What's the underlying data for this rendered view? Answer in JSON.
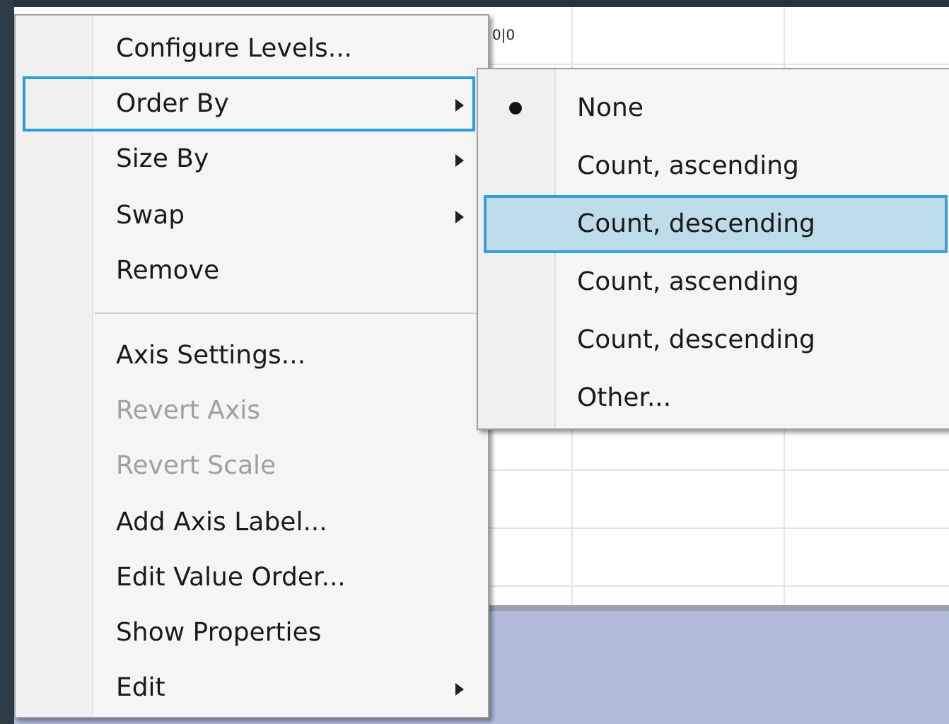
{
  "background": {
    "cell_text": "0|0"
  },
  "context_menu": {
    "items": [
      {
        "kind": "item",
        "label": "Configure Levels...",
        "disabled": false,
        "selected": false,
        "submenu": false
      },
      {
        "kind": "item",
        "label": "Order By",
        "disabled": false,
        "selected": true,
        "submenu": true
      },
      {
        "kind": "item",
        "label": "Size By",
        "disabled": false,
        "selected": false,
        "submenu": true
      },
      {
        "kind": "item",
        "label": "Swap",
        "disabled": false,
        "selected": false,
        "submenu": true
      },
      {
        "kind": "item",
        "label": "Remove",
        "disabled": false,
        "selected": false,
        "submenu": false
      },
      {
        "kind": "separator"
      },
      {
        "kind": "item",
        "label": "Axis Settings...",
        "disabled": false,
        "selected": false,
        "submenu": false
      },
      {
        "kind": "item",
        "label": "Revert Axis",
        "disabled": true,
        "selected": false,
        "submenu": false
      },
      {
        "kind": "item",
        "label": "Revert Scale",
        "disabled": true,
        "selected": false,
        "submenu": false
      },
      {
        "kind": "item",
        "label": "Add Axis Label...",
        "disabled": false,
        "selected": false,
        "submenu": false
      },
      {
        "kind": "item",
        "label": "Edit Value Order...",
        "disabled": false,
        "selected": false,
        "submenu": false
      },
      {
        "kind": "item",
        "label": "Show Properties",
        "disabled": false,
        "selected": false,
        "submenu": false
      },
      {
        "kind": "item",
        "label": "Edit",
        "disabled": false,
        "selected": false,
        "submenu": true
      }
    ]
  },
  "submenu": {
    "items": [
      {
        "label": "None",
        "checked": true,
        "selected": false
      },
      {
        "label": "Count, ascending",
        "checked": false,
        "selected": false
      },
      {
        "label": "Count, descending",
        "checked": false,
        "selected": true
      },
      {
        "label": "Count, ascending",
        "checked": false,
        "selected": false
      },
      {
        "label": "Count, descending",
        "checked": false,
        "selected": false
      },
      {
        "label": "Other...",
        "checked": false,
        "selected": false
      }
    ]
  }
}
